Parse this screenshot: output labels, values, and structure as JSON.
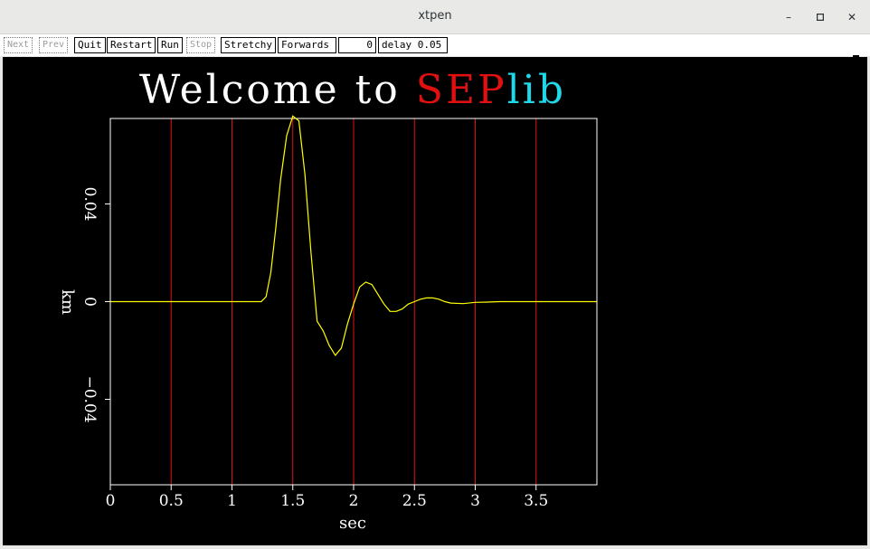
{
  "window": {
    "title": "xtpen"
  },
  "toolbar": {
    "next": "Next",
    "prev": "Prev",
    "quit": "Quit",
    "restart": "Restart",
    "run": "Run",
    "stop": "Stop",
    "stretchy": "Stretchy",
    "forwards": "Forwards",
    "frame": "0",
    "delay": "delay 0.05"
  },
  "plot": {
    "title_part1": "Welcome to ",
    "title_part2": "SEP",
    "title_part3": "lib",
    "colors": {
      "title": "#ffffff",
      "sep": "#e01010",
      "lib": "#20d8e8",
      "trace": "#ffff00",
      "gridlines": "#e01010",
      "axes": "#ffffff"
    }
  },
  "chart_data": {
    "type": "line",
    "xlabel": "sec",
    "ylabel": "km",
    "xlim": [
      0,
      4.0
    ],
    "ylim": [
      -0.075,
      0.075
    ],
    "xticks": [
      0,
      0.5,
      1,
      1.5,
      2,
      2.5,
      3,
      3.5
    ],
    "xtick_labels": [
      "0",
      "0.5",
      "1",
      "1.5",
      "2",
      "2.5",
      "3",
      "3.5"
    ],
    "yticks": [
      0.04,
      0,
      -0.04
    ],
    "ytick_labels": [
      "0.04",
      "0",
      "−0.04"
    ],
    "vertical_gridlines_x": [
      0.5,
      1,
      1.5,
      2,
      2.5,
      3,
      3.5
    ],
    "series": [
      {
        "x": [
          0,
          1.0,
          1.24,
          1.28,
          1.32,
          1.36,
          1.4,
          1.45,
          1.5,
          1.55,
          1.6,
          1.65,
          1.7,
          1.75,
          1.8,
          1.85,
          1.9,
          1.95,
          2.0,
          2.05,
          2.1,
          2.15,
          2.2,
          2.25,
          2.3,
          2.35,
          2.4,
          2.45,
          2.5,
          2.55,
          2.6,
          2.65,
          2.7,
          2.75,
          2.8,
          2.9,
          3.0,
          3.1,
          3.2,
          3.4,
          3.6,
          3.8,
          4.0
        ],
        "y": [
          0,
          0,
          0,
          0.002,
          0.012,
          0.03,
          0.05,
          0.068,
          0.076,
          0.074,
          0.052,
          0.02,
          -0.008,
          -0.012,
          -0.018,
          -0.022,
          -0.019,
          -0.009,
          -0.001,
          0.006,
          0.008,
          0.007,
          0.003,
          -0.001,
          -0.004,
          -0.004,
          -0.003,
          -0.001,
          0.0,
          0.001,
          0.0015,
          0.0015,
          0.001,
          0.0,
          -0.0006,
          -0.0008,
          -0.0003,
          -0.0002,
          0.0,
          0.0,
          0.0,
          0.0,
          0.0
        ]
      }
    ]
  }
}
